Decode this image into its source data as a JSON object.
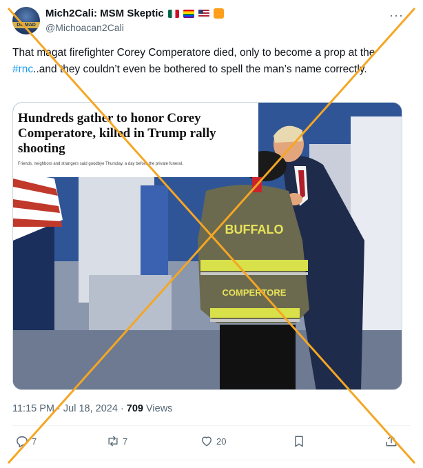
{
  "author": {
    "display_name": "Mich2Cali: MSM Skeptic",
    "handle": "@Michoacan2Cali",
    "avatar_text": "DE MAD"
  },
  "tweet": {
    "text_before": "That magat firefighter Corey Comperatore died, only to become a prop at the ",
    "hashtag": "#rnc",
    "text_after": "..and they couldn’t even be bothered to spell the man’s name correctly."
  },
  "media": {
    "headline": "Hundreds gather to honor Corey Comperatore, killed in Trump rally shooting",
    "subhead": "Friends, neighbors and strangers said goodbye Thursday, a day before the private funeral.",
    "jacket_top": "BUFFALO",
    "jacket_name": "COMPERTORE"
  },
  "meta": {
    "time": "11:15 PM · Jul 18, 2024 · ",
    "views_count": "709",
    "views_label": " Views"
  },
  "actions": {
    "replies": "7",
    "reposts": "7",
    "likes": "20"
  },
  "colors": {
    "accent": "#1d9bf0",
    "cross": "#f5a623",
    "muted": "#536471"
  },
  "icons": [
    "more-icon",
    "reply-icon",
    "repost-icon",
    "like-icon",
    "bookmark-icon",
    "share-icon"
  ]
}
